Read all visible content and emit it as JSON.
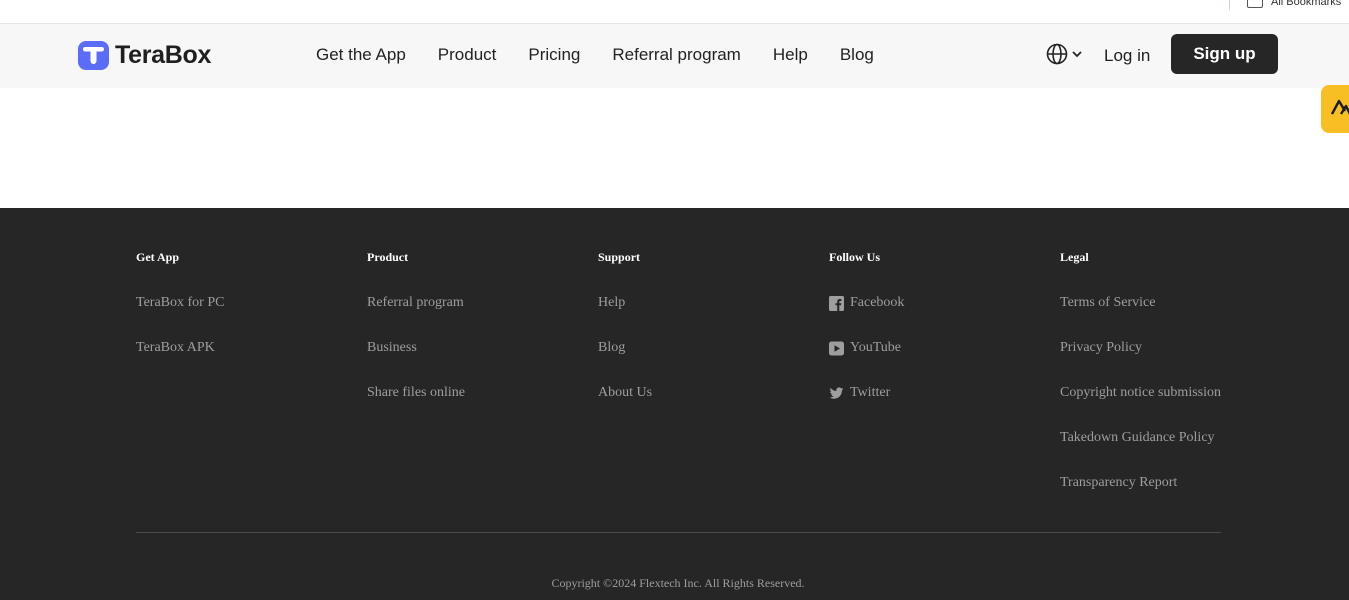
{
  "browser": {
    "bookmarks_label": "All Bookmarks"
  },
  "header": {
    "logo_text": "TeraBox",
    "nav": [
      {
        "label": "Get the App"
      },
      {
        "label": "Product"
      },
      {
        "label": "Pricing"
      },
      {
        "label": "Referral program"
      },
      {
        "label": "Help"
      },
      {
        "label": "Blog"
      }
    ],
    "language_icon": "globe-icon",
    "login_label": "Log in",
    "signup_label": "Sign up"
  },
  "footer": {
    "columns": [
      {
        "title": "Get App",
        "links": [
          "TeraBox for PC",
          "TeraBox APK"
        ]
      },
      {
        "title": "Product",
        "links": [
          "Referral program",
          "Business",
          "Share files online"
        ]
      },
      {
        "title": "Support",
        "links": [
          "Help",
          "Blog",
          "About Us"
        ]
      },
      {
        "title": "Follow Us",
        "links": [
          "Facebook",
          "YouTube",
          "Twitter"
        ]
      },
      {
        "title": "Legal",
        "links": [
          "Terms of Service",
          "Privacy Policy",
          "Copyright notice submission",
          "Takedown Guidance Policy",
          "Transparency Report"
        ]
      }
    ],
    "copyright": "Copyright ©2024 Flextech Inc. All Rights Reserved."
  },
  "colors": {
    "header_bg": "#f7f7f7",
    "footer_bg": "#262626",
    "signup_bg": "#262626",
    "logo_accent": "#5b6cf6",
    "widget_bg": "#f8bf25"
  }
}
